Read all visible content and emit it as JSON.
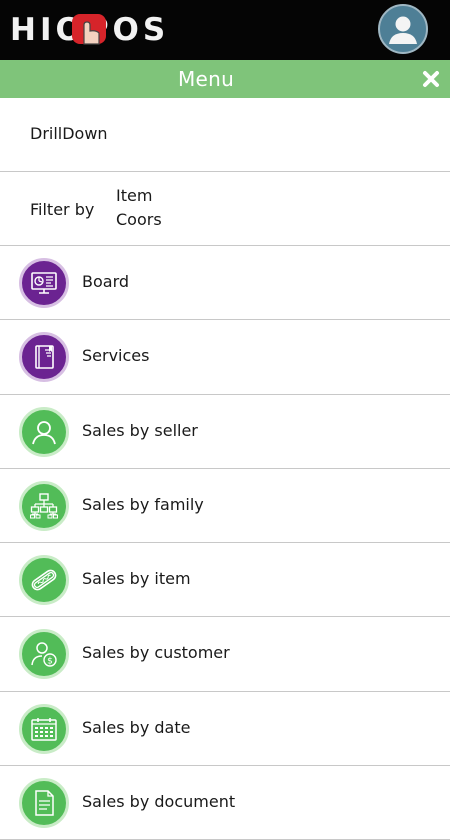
{
  "header": {
    "logo_text": "HIOPOS",
    "avatar_icon": "user-icon"
  },
  "menu_bar": {
    "title": "Menu",
    "close_icon": "close-icon",
    "color": "#7fc47a"
  },
  "drilldown": {
    "label": "DrillDown"
  },
  "filter": {
    "label": "Filter by",
    "values": [
      "Item",
      "Coors"
    ]
  },
  "menu_items": [
    {
      "label": "Board",
      "icon": "dashboard-icon",
      "color": "#6b2391"
    },
    {
      "label": "Services",
      "icon": "notebook-icon",
      "color": "#6b2391"
    },
    {
      "label": "Sales by seller",
      "icon": "person-icon",
      "color": "#52bc58"
    },
    {
      "label": "Sales by family",
      "icon": "hierarchy-icon",
      "color": "#52bc58"
    },
    {
      "label": "Sales by item",
      "icon": "hotdog-icon",
      "color": "#52bc58"
    },
    {
      "label": "Sales by customer",
      "icon": "customer-money-icon",
      "color": "#52bc58"
    },
    {
      "label": "Sales by date",
      "icon": "calendar-icon",
      "color": "#52bc58"
    },
    {
      "label": "Sales by document",
      "icon": "document-icon",
      "color": "#52bc58"
    }
  ]
}
